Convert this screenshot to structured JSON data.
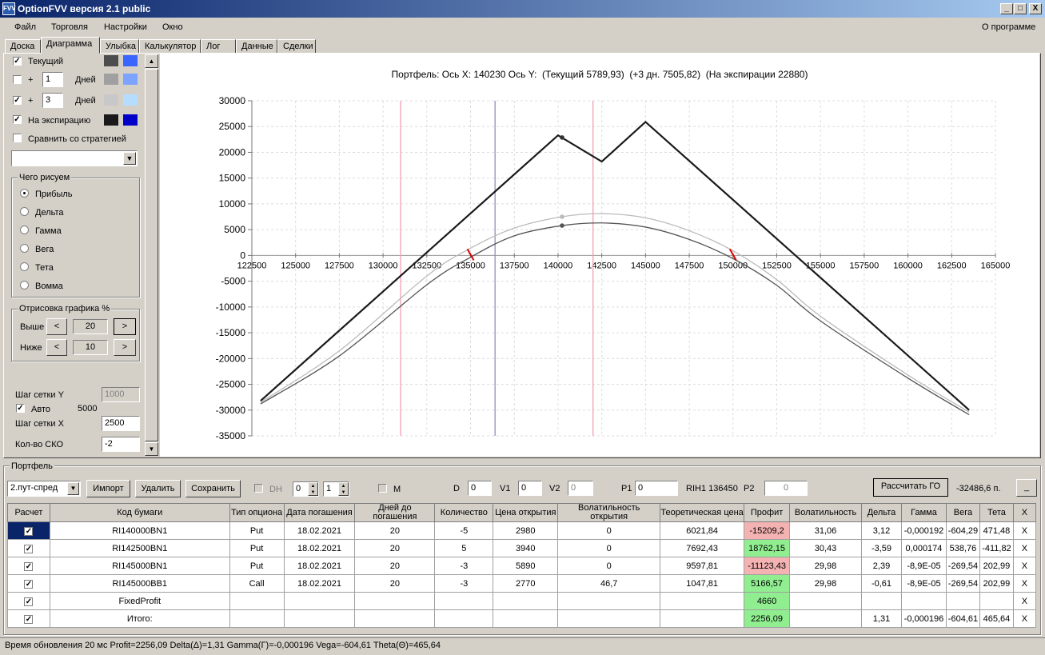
{
  "window": {
    "title": "OptionFVV версия 2.1 public",
    "icon": "app-icon",
    "minimize": "_",
    "maximize": "□",
    "close": "X"
  },
  "menu": {
    "items": [
      "Файл",
      "Торговля",
      "Настройки",
      "Окно"
    ],
    "about": "О программе"
  },
  "tabs": [
    "Доска",
    "Диаграмма",
    "Улыбка",
    "Калькулятор",
    "Лог",
    "Данные",
    "Сделки"
  ],
  "active_tab": "Диаграмма",
  "left": {
    "current": "Текущий",
    "plus": "+",
    "days1": "1",
    "days_label": "Дней",
    "days2": "3",
    "expiration": "На экспирацию",
    "compare": "Сравнить со стратегией",
    "colors": {
      "current": [
        "#4d4d4d",
        "#3a66ff"
      ],
      "d1": [
        "#a0a0a0",
        "#7ba3ff"
      ],
      "d3": [
        "#c8c8c8",
        "#b5ddff"
      ],
      "exp": [
        "#1a1a1a",
        "#0000c8"
      ]
    },
    "draw_group": "Чего рисуем",
    "radios": [
      "Прибыль",
      "Дельта",
      "Гамма",
      "Вега",
      "Тета",
      "Вомма"
    ],
    "plot_group": "Отрисовка графика %",
    "above": "Выше",
    "above_val": "20",
    "below": "Ниже",
    "below_val": "10",
    "prev": "<",
    "next": ">",
    "grid_y": "Шаг сетки Y",
    "grid_y_val": "1000",
    "auto": "Авто",
    "auto_val": "5000",
    "grid_x": "Шаг сетки X",
    "grid_x_val": "2500",
    "sko": "Кол-во СКО",
    "sko_val": "-2"
  },
  "chart_data": {
    "type": "line",
    "title": "Портфель: Ось X: 140230 Ось Y:  (Текущий 5789,93)  (+3 дн. 7505,82)  (На экспирации 22880)",
    "xlim": [
      122500,
      165000
    ],
    "ylim": [
      -35000,
      30000
    ],
    "x_ticks": [
      122500,
      125000,
      127500,
      130000,
      132500,
      135000,
      137500,
      140000,
      142500,
      145000,
      147500,
      150000,
      152500,
      155000,
      157500,
      160000,
      162500,
      165000
    ],
    "y_ticks": [
      30000,
      25000,
      20000,
      15000,
      10000,
      5000,
      0,
      -5000,
      -10000,
      -15000,
      -20000,
      -25000,
      -30000,
      -35000
    ],
    "grid": true,
    "vlines": [
      {
        "x": 131000,
        "color": "#f0a0b0"
      },
      {
        "x": 136400,
        "color": "#9090b8"
      },
      {
        "x": 142000,
        "color": "#f0a0b0"
      }
    ],
    "series": [
      {
        "key": "exp",
        "color": "#1a1a1a",
        "width": 2.2,
        "x": [
          123000,
          140000,
          142500,
          145000,
          163500
        ],
        "y": [
          -28200,
          23300,
          18200,
          25900,
          -30000
        ]
      },
      {
        "key": "cur",
        "color": "#555555",
        "width": 1.3,
        "x": [
          123000,
          127500,
          132500,
          135000,
          137500,
          140230,
          142500,
          145000,
          147500,
          150000,
          152500,
          155000,
          160000,
          163500
        ],
        "y": [
          -28800,
          -19500,
          -5700,
          -350,
          3800,
          5790,
          6300,
          5500,
          3100,
          -600,
          -5800,
          -12700,
          -23800,
          -30900
        ]
      },
      {
        "key": "d3",
        "color": "#bbbbbb",
        "width": 1.3,
        "x": [
          123000,
          127500,
          132500,
          135000,
          137500,
          140230,
          142500,
          145000,
          147500,
          150000,
          152500,
          155000,
          160000,
          163500
        ],
        "y": [
          -28500,
          -18500,
          -4000,
          1400,
          5300,
          7506,
          8100,
          7300,
          4800,
          900,
          -4700,
          -11800,
          -23200,
          -30400
        ]
      }
    ],
    "markers": [
      {
        "x": 140230,
        "y": 22880,
        "color": "#333333"
      },
      {
        "x": 140230,
        "y": 5790,
        "color": "#555555"
      },
      {
        "x": 140230,
        "y": 7506,
        "color": "#bbbbbb"
      }
    ],
    "ticks_red": [
      135000,
      150000
    ]
  },
  "portfolio": {
    "group": "Портфель",
    "strategy": "2.пут-спред",
    "import": "Импорт",
    "delete": "Удалить",
    "save": "Сохранить",
    "dh": "DH",
    "dh_v1": "0",
    "dh_v2": "1",
    "m": "M",
    "d": "D",
    "d_val": "0",
    "v1": "V1",
    "v1_val": "0",
    "v2": "V2",
    "v2_val": "0",
    "p1": "P1",
    "p1_val": "0",
    "rih": "RIH1 136450",
    "p2": "P2",
    "p2_val": "0",
    "calc_go": "Рассчитать ГО",
    "go_val": "-32486,6 п.",
    "min": "_",
    "headers": [
      "Расчет",
      "Код бумаги",
      "Тип опциона",
      "Дата погашения",
      "Дней до погашения",
      "Количество",
      "Цена открытия",
      "Волатильность открытия",
      "Теоретическая цена",
      "Профит",
      "Волатильность",
      "Дельта",
      "Гамма",
      "Вега",
      "Тета",
      "X"
    ],
    "rows": [
      {
        "code": "RI140000BN1",
        "type": "Put",
        "date": "18.02.2021",
        "days": "20",
        "qty": "-5",
        "price": "2980",
        "vol_open": "0",
        "theo": "6021,84",
        "profit": "-15209,2",
        "pc": "#f4b2b2",
        "vol": "31,06",
        "delta": "3,12",
        "gamma": "-0,000192",
        "vega": "-604,29",
        "theta": "471,48",
        "x": "X"
      },
      {
        "code": "RI142500BN1",
        "type": "Put",
        "date": "18.02.2021",
        "days": "20",
        "qty": "5",
        "price": "3940",
        "vol_open": "0",
        "theo": "7692,43",
        "profit": "18762,15",
        "pc": "#90ee90",
        "vol": "30,43",
        "delta": "-3,59",
        "gamma": "0,000174",
        "vega": "538,76",
        "theta": "-411,82",
        "x": "X"
      },
      {
        "code": "RI145000BN1",
        "type": "Put",
        "date": "18.02.2021",
        "days": "20",
        "qty": "-3",
        "price": "5890",
        "vol_open": "0",
        "theo": "9597,81",
        "profit": "-11123,43",
        "pc": "#f4b2b2",
        "vol": "29,98",
        "delta": "2,39",
        "gamma": "-8,9E-05",
        "vega": "-269,54",
        "theta": "202,99",
        "x": "X"
      },
      {
        "code": "RI145000BB1",
        "type": "Call",
        "date": "18.02.2021",
        "days": "20",
        "qty": "-3",
        "price": "2770",
        "vol_open": "46,7",
        "theo": "1047,81",
        "profit": "5166,57",
        "pc": "#90ee90",
        "vol": "29,98",
        "delta": "-0,61",
        "gamma": "-8,9E-05",
        "vega": "-269,54",
        "theta": "202,99",
        "x": "X"
      },
      {
        "code": "FixedProfit",
        "type": "",
        "date": "",
        "days": "",
        "qty": "",
        "price": "",
        "vol_open": "",
        "theo": "",
        "profit": "4660",
        "pc": "#90ee90",
        "vol": "",
        "delta": "",
        "gamma": "",
        "vega": "",
        "theta": "",
        "x": "X"
      },
      {
        "code": "Итого:",
        "type": "",
        "date": "",
        "days": "",
        "qty": "",
        "price": "",
        "vol_open": "",
        "theo": "",
        "profit": "2256,09",
        "pc": "#90ee90",
        "vol": "",
        "delta": "1,31",
        "gamma": "-0,000196",
        "vega": "-604,61",
        "theta": "465,64",
        "x": "X"
      }
    ]
  },
  "status": "Время обновления 20 мс  Profit=2256,09 Delta(Δ)=1,31 Gamma(Γ)=-0,000196 Vega=-604,61 Theta(Θ)=465,64"
}
